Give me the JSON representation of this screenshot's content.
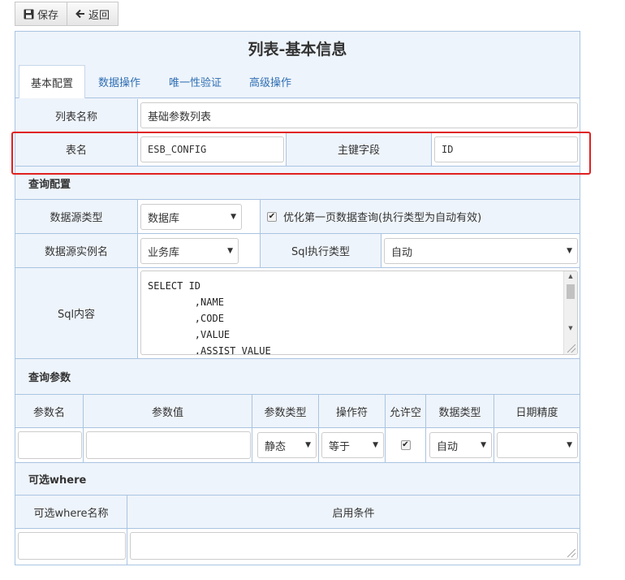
{
  "toolbar": {
    "save_label": "保存",
    "back_label": "返回"
  },
  "title": "列表-基本信息",
  "tabs": [
    "基本配置",
    "数据操作",
    "唯一性验证",
    "高级操作"
  ],
  "basic": {
    "list_name_label": "列表名称",
    "list_name_value": "基础参数列表",
    "table_name_label": "表名",
    "table_name_value": "ESB_CONFIG",
    "pk_label": "主键字段",
    "pk_value": "ID"
  },
  "query_config": {
    "section_label": "查询配置",
    "datasource_type_label": "数据源类型",
    "datasource_type_value": "数据库",
    "optimize_checked": true,
    "optimize_label": "优化第一页数据查询(执行类型为自动有效)",
    "datasource_instance_label": "数据源实例名",
    "datasource_instance_value": "业务库",
    "sql_exec_type_label": "Sql执行类型",
    "sql_exec_type_value": "自动",
    "sql_content_label": "Sql内容",
    "sql_content": "SELECT ID\n        ,NAME\n        ,CODE\n        ,VALUE\n        ,ASSIST_VALUE"
  },
  "query_params": {
    "section_label": "查询参数",
    "headers": [
      "参数名",
      "参数值",
      "参数类型",
      "操作符",
      "允许空",
      "数据类型",
      "日期精度"
    ],
    "row": {
      "param_type": "静态",
      "operator": "等于",
      "allow_null": true,
      "data_type": "自动",
      "date_precision": ""
    }
  },
  "optional_where": {
    "section_label": "可选where",
    "headers": [
      "可选where名称",
      "启用条件"
    ]
  }
}
